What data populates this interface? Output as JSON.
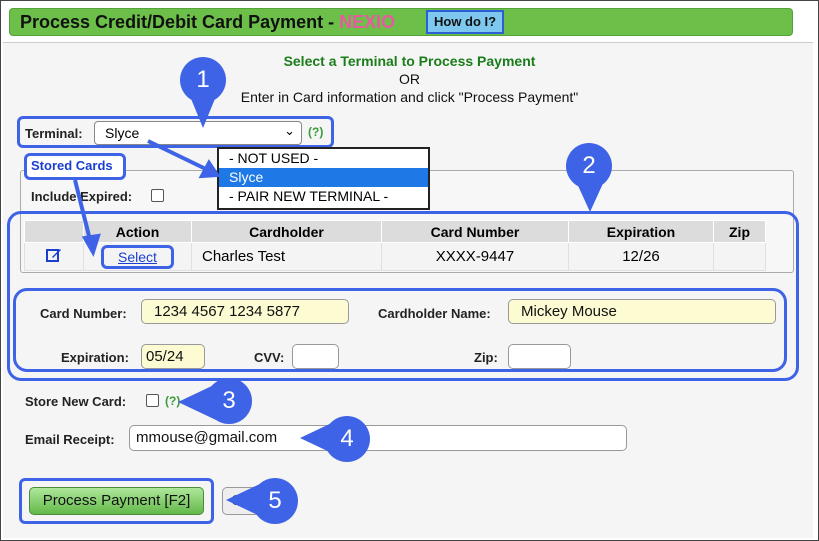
{
  "header": {
    "title": "Process Credit/Debit Card Payment - ",
    "brand": "NEXIO",
    "help_button": "How do I?"
  },
  "instructions": {
    "line1": "Select a Terminal to Process Payment",
    "line2": "OR",
    "line3": "Enter in Card information and click \"Process Payment\""
  },
  "terminal": {
    "label": "Terminal:",
    "selected": "Slyce",
    "help": "(?)",
    "options": [
      "- NOT USED -",
      "Slyce",
      "- PAIR NEW TERMINAL -"
    ]
  },
  "stored_cards": {
    "title": "Stored Cards",
    "include_expired_label": "Include Expired:",
    "columns": [
      "",
      "Action",
      "Cardholder",
      "Card Number",
      "Expiration",
      "Zip"
    ],
    "rows": [
      {
        "action": "Select",
        "cardholder": "Charles Test",
        "card_number": "XXXX-9447",
        "expiration": "12/26",
        "zip": ""
      }
    ]
  },
  "card_form": {
    "card_number_label": "Card Number:",
    "card_number": "1234 4567 1234 5877",
    "cardholder_label": "Cardholder Name:",
    "cardholder": "Mickey Mouse",
    "expiration_label": "Expiration:",
    "expiration": "05/24",
    "cvv_label": "CVV:",
    "cvv": "",
    "zip_label": "Zip:",
    "zip": ""
  },
  "store_card": {
    "label": "Store New Card:",
    "help": "(?)"
  },
  "email": {
    "label": "Email Receipt:",
    "value": "mmouse@gmail.com"
  },
  "actions": {
    "process_label": "Process Payment [F2]",
    "cancel_label": "C"
  },
  "callouts": [
    "1",
    "2",
    "3",
    "4",
    "5"
  ],
  "colors": {
    "accent": "#3e63e6",
    "title_bar": "#6cc04a",
    "brand": "#e85aa0"
  }
}
